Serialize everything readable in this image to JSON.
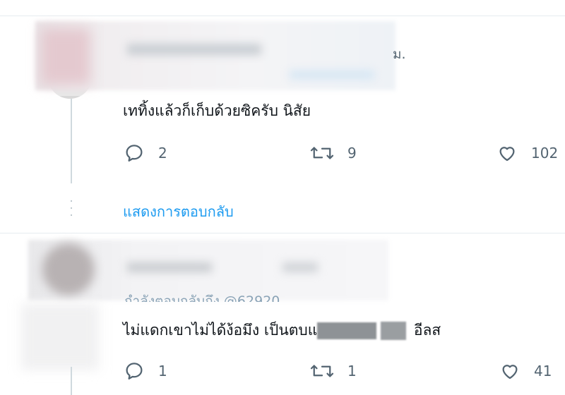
{
  "tweets": [
    {
      "time_fragment": "ม.",
      "text": "เททิ้งแล้วก็เก็บด้วยซิครับ นิสัย",
      "reply_count": "2",
      "retweet_count": "9",
      "like_count": "102"
    },
    {
      "replying_to": "กำลังตอบกลับถึง @62920_",
      "text_before_censor": "ไม่แดกเขาไม่ได้ง้อมึง เป็นตบแ",
      "text_after_censor": " อีลส",
      "reply_count": "1",
      "retweet_count": "1",
      "like_count": "41"
    }
  ],
  "show_replies_label": "แสดงการตอบกลับ",
  "colors": {
    "accent": "#1d9bf0",
    "muted": "#536471",
    "divider": "#e6ecf0"
  },
  "icons": [
    "reply-icon",
    "retweet-icon",
    "like-icon"
  ]
}
